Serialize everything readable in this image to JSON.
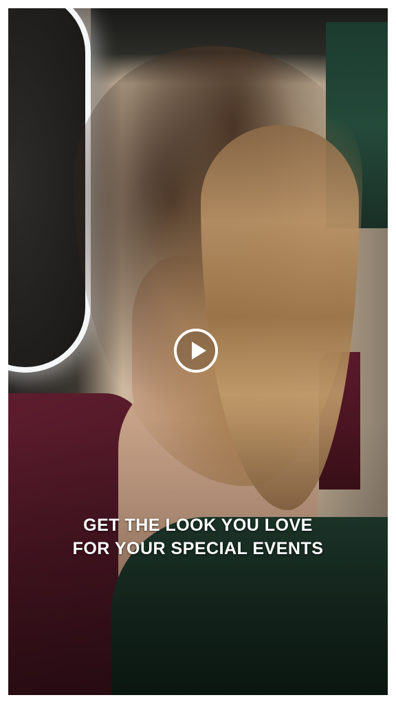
{
  "video": {
    "caption_lines": [
      "GET THE LOOK YOU LOVE",
      "FOR YOUR SPECIAL EVENTS"
    ],
    "play_icon": "play-icon",
    "colors": {
      "play_button": "#ffffff",
      "caption_text": "#ffffff"
    }
  }
}
